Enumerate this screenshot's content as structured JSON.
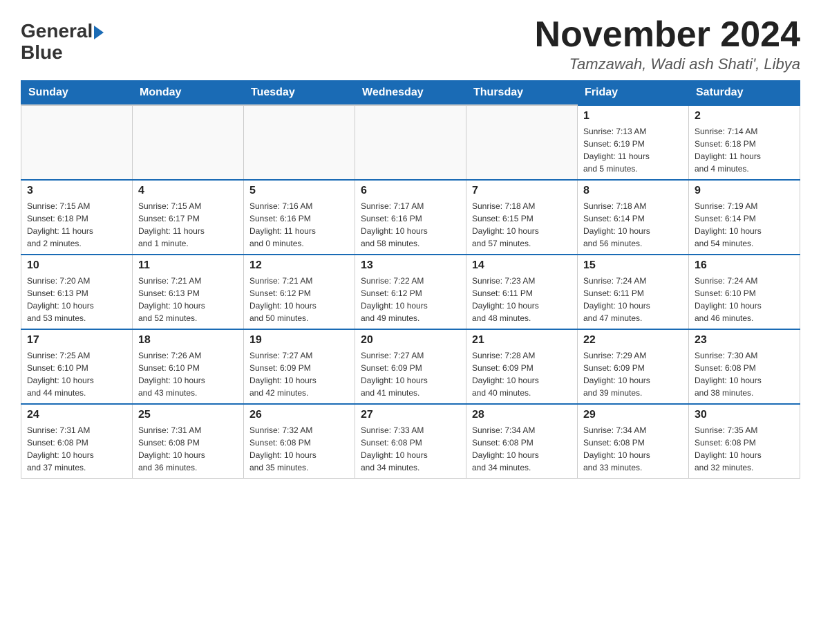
{
  "header": {
    "logo_text_general": "General",
    "logo_text_blue": "Blue",
    "month_title": "November 2024",
    "location": "Tamzawah, Wadi ash Shati', Libya"
  },
  "weekdays": [
    "Sunday",
    "Monday",
    "Tuesday",
    "Wednesday",
    "Thursday",
    "Friday",
    "Saturday"
  ],
  "weeks": [
    {
      "days": [
        {
          "num": "",
          "info": ""
        },
        {
          "num": "",
          "info": ""
        },
        {
          "num": "",
          "info": ""
        },
        {
          "num": "",
          "info": ""
        },
        {
          "num": "",
          "info": ""
        },
        {
          "num": "1",
          "info": "Sunrise: 7:13 AM\nSunset: 6:19 PM\nDaylight: 11 hours\nand 5 minutes."
        },
        {
          "num": "2",
          "info": "Sunrise: 7:14 AM\nSunset: 6:18 PM\nDaylight: 11 hours\nand 4 minutes."
        }
      ]
    },
    {
      "days": [
        {
          "num": "3",
          "info": "Sunrise: 7:15 AM\nSunset: 6:18 PM\nDaylight: 11 hours\nand 2 minutes."
        },
        {
          "num": "4",
          "info": "Sunrise: 7:15 AM\nSunset: 6:17 PM\nDaylight: 11 hours\nand 1 minute."
        },
        {
          "num": "5",
          "info": "Sunrise: 7:16 AM\nSunset: 6:16 PM\nDaylight: 11 hours\nand 0 minutes."
        },
        {
          "num": "6",
          "info": "Sunrise: 7:17 AM\nSunset: 6:16 PM\nDaylight: 10 hours\nand 58 minutes."
        },
        {
          "num": "7",
          "info": "Sunrise: 7:18 AM\nSunset: 6:15 PM\nDaylight: 10 hours\nand 57 minutes."
        },
        {
          "num": "8",
          "info": "Sunrise: 7:18 AM\nSunset: 6:14 PM\nDaylight: 10 hours\nand 56 minutes."
        },
        {
          "num": "9",
          "info": "Sunrise: 7:19 AM\nSunset: 6:14 PM\nDaylight: 10 hours\nand 54 minutes."
        }
      ]
    },
    {
      "days": [
        {
          "num": "10",
          "info": "Sunrise: 7:20 AM\nSunset: 6:13 PM\nDaylight: 10 hours\nand 53 minutes."
        },
        {
          "num": "11",
          "info": "Sunrise: 7:21 AM\nSunset: 6:13 PM\nDaylight: 10 hours\nand 52 minutes."
        },
        {
          "num": "12",
          "info": "Sunrise: 7:21 AM\nSunset: 6:12 PM\nDaylight: 10 hours\nand 50 minutes."
        },
        {
          "num": "13",
          "info": "Sunrise: 7:22 AM\nSunset: 6:12 PM\nDaylight: 10 hours\nand 49 minutes."
        },
        {
          "num": "14",
          "info": "Sunrise: 7:23 AM\nSunset: 6:11 PM\nDaylight: 10 hours\nand 48 minutes."
        },
        {
          "num": "15",
          "info": "Sunrise: 7:24 AM\nSunset: 6:11 PM\nDaylight: 10 hours\nand 47 minutes."
        },
        {
          "num": "16",
          "info": "Sunrise: 7:24 AM\nSunset: 6:10 PM\nDaylight: 10 hours\nand 46 minutes."
        }
      ]
    },
    {
      "days": [
        {
          "num": "17",
          "info": "Sunrise: 7:25 AM\nSunset: 6:10 PM\nDaylight: 10 hours\nand 44 minutes."
        },
        {
          "num": "18",
          "info": "Sunrise: 7:26 AM\nSunset: 6:10 PM\nDaylight: 10 hours\nand 43 minutes."
        },
        {
          "num": "19",
          "info": "Sunrise: 7:27 AM\nSunset: 6:09 PM\nDaylight: 10 hours\nand 42 minutes."
        },
        {
          "num": "20",
          "info": "Sunrise: 7:27 AM\nSunset: 6:09 PM\nDaylight: 10 hours\nand 41 minutes."
        },
        {
          "num": "21",
          "info": "Sunrise: 7:28 AM\nSunset: 6:09 PM\nDaylight: 10 hours\nand 40 minutes."
        },
        {
          "num": "22",
          "info": "Sunrise: 7:29 AM\nSunset: 6:09 PM\nDaylight: 10 hours\nand 39 minutes."
        },
        {
          "num": "23",
          "info": "Sunrise: 7:30 AM\nSunset: 6:08 PM\nDaylight: 10 hours\nand 38 minutes."
        }
      ]
    },
    {
      "days": [
        {
          "num": "24",
          "info": "Sunrise: 7:31 AM\nSunset: 6:08 PM\nDaylight: 10 hours\nand 37 minutes."
        },
        {
          "num": "25",
          "info": "Sunrise: 7:31 AM\nSunset: 6:08 PM\nDaylight: 10 hours\nand 36 minutes."
        },
        {
          "num": "26",
          "info": "Sunrise: 7:32 AM\nSunset: 6:08 PM\nDaylight: 10 hours\nand 35 minutes."
        },
        {
          "num": "27",
          "info": "Sunrise: 7:33 AM\nSunset: 6:08 PM\nDaylight: 10 hours\nand 34 minutes."
        },
        {
          "num": "28",
          "info": "Sunrise: 7:34 AM\nSunset: 6:08 PM\nDaylight: 10 hours\nand 34 minutes."
        },
        {
          "num": "29",
          "info": "Sunrise: 7:34 AM\nSunset: 6:08 PM\nDaylight: 10 hours\nand 33 minutes."
        },
        {
          "num": "30",
          "info": "Sunrise: 7:35 AM\nSunset: 6:08 PM\nDaylight: 10 hours\nand 32 minutes."
        }
      ]
    }
  ]
}
